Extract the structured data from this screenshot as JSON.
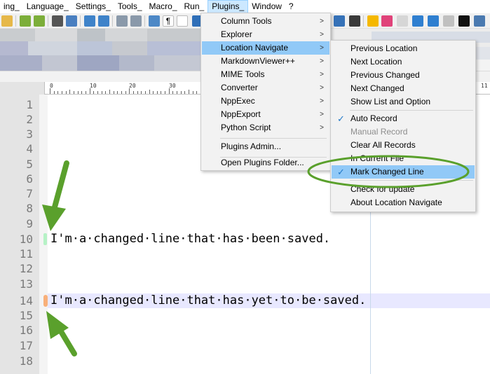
{
  "menubar": {
    "items": [
      "ing_",
      "Language_",
      "Settings_",
      "Tools_",
      "Macro_",
      "Run_",
      "Plugins_",
      "Window",
      "?"
    ]
  },
  "plugins_menu": {
    "items": [
      {
        "label": "Column Tools",
        "submenu": true
      },
      {
        "label": "Explorer",
        "submenu": true
      },
      {
        "label": "Location Navigate",
        "submenu": true,
        "highlighted": true
      },
      {
        "label": "MarkdownViewer++",
        "submenu": true
      },
      {
        "label": "MIME Tools",
        "submenu": true
      },
      {
        "label": "Converter",
        "submenu": true
      },
      {
        "label": "NppExec",
        "submenu": true
      },
      {
        "label": "NppExport",
        "submenu": true
      },
      {
        "label": "Python Script",
        "submenu": true
      },
      {
        "label": "Plugins Admin...",
        "submenu": false
      },
      {
        "label": "Open Plugins Folder...",
        "submenu": false
      }
    ]
  },
  "location_navigate_menu": {
    "items": [
      {
        "label": "Previous Location"
      },
      {
        "label": "Next Location"
      },
      {
        "label": "Previous Changed"
      },
      {
        "label": "Next Changed"
      },
      {
        "label": "Show List and Option"
      },
      {
        "label": "Auto Record",
        "checked": true
      },
      {
        "label": "Manual Record",
        "disabled": true
      },
      {
        "label": "Clear All Records"
      },
      {
        "label": "In Current File"
      },
      {
        "label": "Mark Changed Line",
        "checked": true,
        "highlighted": true
      },
      {
        "label": "Check for update"
      },
      {
        "label": "About Location Navigate"
      }
    ]
  },
  "ruler": {
    "labels": [
      "0",
      "10",
      "20",
      "30",
      "11"
    ]
  },
  "editor": {
    "line_numbers": [
      "1",
      "2",
      "3",
      "4",
      "5",
      "6",
      "7",
      "8",
      "9",
      "10",
      "11",
      "12",
      "13",
      "14",
      "15",
      "16",
      "17",
      "18"
    ],
    "line_10": "I'm·a·changed·line·that·has·been·saved.",
    "line_14": "I'm·a·changed·line·that·has·yet·to·be·saved."
  },
  "colors": {
    "saved_marker": "#b6f2c6",
    "unsaved_marker": "#f8b07a",
    "menu_highlight": "#91c9f7",
    "annotation": "#5aa02c"
  }
}
